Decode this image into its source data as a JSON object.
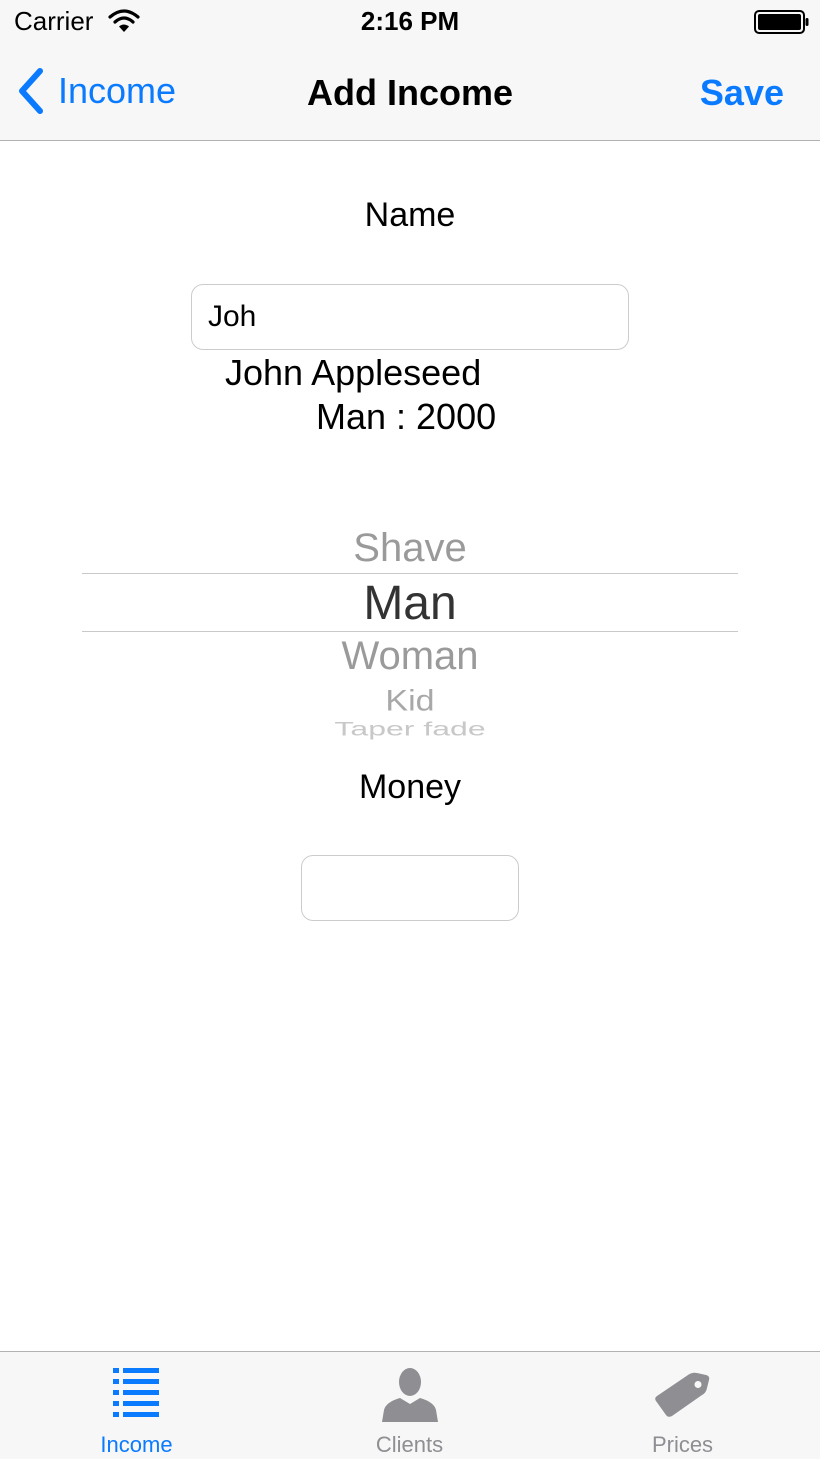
{
  "status_bar": {
    "carrier": "Carrier",
    "time": "2:16 PM",
    "icons": [
      "wifi-icon",
      "battery-icon"
    ]
  },
  "nav": {
    "back_label": "Income",
    "title": "Add Income",
    "save_label": "Save",
    "tint_color": "#0a7aff"
  },
  "form": {
    "name_label": "Name",
    "name_value": "Joh",
    "suggestion_name": "John Appleseed",
    "suggestion_detail": "Man : 2000",
    "money_label": "Money",
    "money_value": ""
  },
  "picker": {
    "rows": [
      "Shave",
      "Man",
      "Woman",
      "Kid",
      "Taper fade"
    ],
    "selected": "Man"
  },
  "tab_bar": {
    "tabs": [
      {
        "label": "Income",
        "icon": "list-icon",
        "active": true
      },
      {
        "label": "Clients",
        "icon": "person-icon",
        "active": false
      },
      {
        "label": "Prices",
        "icon": "price-tag-icon",
        "active": false
      }
    ],
    "active_color": "#0a7aff",
    "inactive_color": "#8e8e93"
  }
}
